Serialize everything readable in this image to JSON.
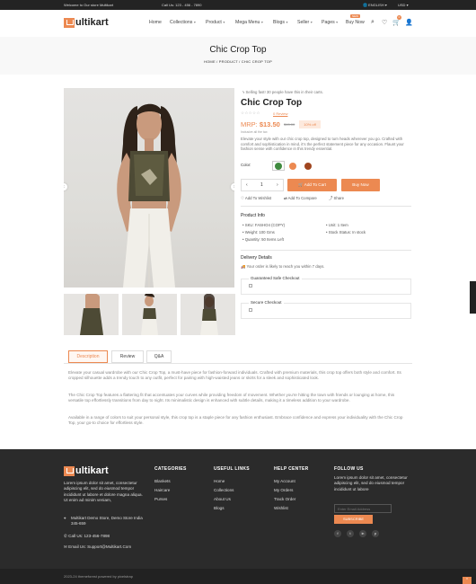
{
  "topbar": {
    "welcome": "Welcome to Our store Multikart",
    "call": "Call Us: 123 - 456 - 7890",
    "language": "ENGLISH",
    "currency": "USD"
  },
  "header": {
    "logo_text": "ultikart",
    "nav": [
      "Home",
      "Collections",
      "Product",
      "Mega Menu",
      "Blogs",
      "Seller",
      "Pages",
      "Buy Now"
    ],
    "new_badge": "NEW",
    "cart_count": "0"
  },
  "banner": {
    "title": "Chic Crop Top",
    "breadcrumb": "HOME / PRODUCT / CHIC CROP TOP"
  },
  "product": {
    "sold_notice": "Selling fast! 30 people have this in their carts.",
    "title": "Chic Crop Top",
    "stars": "☆☆☆☆☆",
    "review_label": "0 Review",
    "mrp_label": "MRP:",
    "price": "$13.50",
    "old_price": "$15.00",
    "discount": "10% off",
    "tax_note": "Inclusive all the tax",
    "description": "Elevate your style with our chic crop top, designed to turn heads wherever you go. Crafted with comfort and sophistication in mind, it's the perfect statement piece for any occasion. Flaunt your fashion sense with confidence in this trendy essential.",
    "color_label": "Color:",
    "colors": [
      "#3f8a3f",
      "#ec8951",
      "#a0451f"
    ],
    "quantity": "1",
    "add_to_cart": "Add To Cart",
    "buy_now": "Buy Now",
    "add_wishlist": "Add To Wishlist",
    "add_compare": "Add To Compare",
    "share": "Share",
    "info_title": "Product Info",
    "info_left": [
      "SKU: FASHO4 (COPY)",
      "Weight: 100 Gms",
      "Quantity: 50 Items Left"
    ],
    "info_right": [
      "Unit: 1 Item",
      "Stock Status: In stock"
    ],
    "delivery_title": "Delivery Details",
    "delivery_text": "Your order is likely to reach you within 7 days.",
    "guaranteed_title": "Guaranteed Safe Checkout",
    "secure_title": "Secure Checkout"
  },
  "tabs": {
    "items": [
      "Description",
      "Review",
      "Q&A"
    ],
    "paragraphs": [
      "Elevate your casual wardrobe with our Chic Crop Top, a must-have piece for fashion-forward individuals. Crafted with premium materials, this crop top offers both style and comfort. Its cropped silhouette adds a trendy touch to any outfit, perfect for pairing with high-waisted jeans or skirts for a sleek and sophisticated look.",
      "The Chic Crop Top features a flattering fit that accentuates your curves while providing freedom of movement. Whether you're hitting the town with friends or lounging at home, this versatile top effortlessly transitions from day to night. Its minimalistic design is enhanced with subtle details, making it a timeless addition to your wardrobe.",
      "Available in a range of colors to suit your personal style, this crop top is a staple piece for any fashion enthusiast. Embrace confidence and express your individuality with the Chic Crop Top, your go-to choice for effortless style."
    ]
  },
  "footer": {
    "logo_text": "ultikart",
    "about": "Lorem ipsum dolor sit amet, consectetur adipiscing elit, sed do eiusmod tempor incididunt ut labore et dolore magna aliqua. Ut enim ad minim veniam,",
    "address": "Multikart Demo Store, Demo Store India 345-659",
    "phone": "Call Us: 123-456-7898",
    "email": "Email Us: Support@Multikart.Com",
    "categories_title": "CATEGORIES",
    "categories": [
      "Blankets",
      "Haircare",
      "Purses"
    ],
    "links_title": "USEFUL LINKS",
    "links": [
      "Home",
      "Collections",
      "About Us",
      "Blogs"
    ],
    "help_title": "HELP CENTER",
    "help": [
      "My Account",
      "My Orders",
      "Track Order",
      "Wishlist"
    ],
    "follow_title": "FOLLOW US",
    "follow_text": "Lorem ipsum dolor sit amet, consectetur adipiscing elit, sed do eiusmod tempor incididunt ut labore",
    "email_placeholder": "Enter Email Address",
    "subscribe": "SUBSCRIBE",
    "social": [
      "f",
      "t",
      "in",
      "p"
    ],
    "copyright": "2023-24 themeforest powered by pixelstrap"
  }
}
